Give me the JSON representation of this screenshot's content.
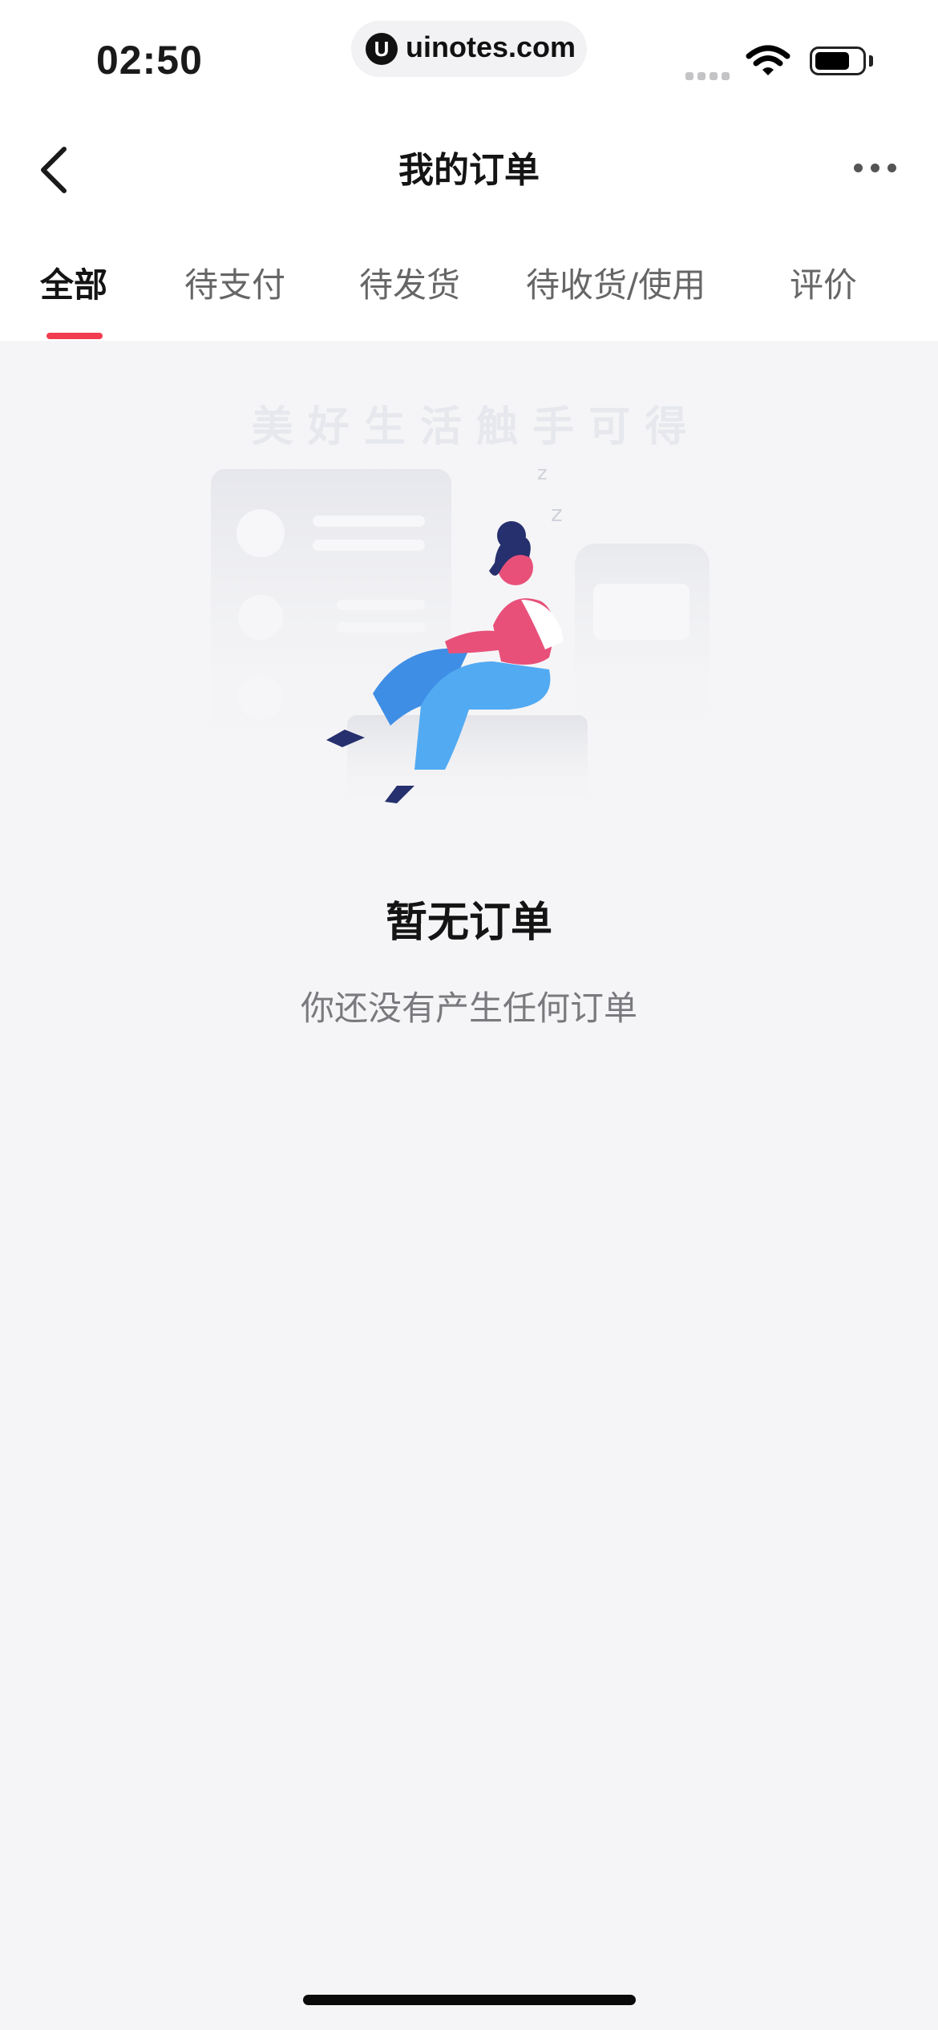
{
  "status_bar": {
    "time": "02:50",
    "url_logo": "U",
    "url": "uinotes.com",
    "icons": [
      "signal-icon",
      "wifi-icon",
      "battery-icon"
    ]
  },
  "nav": {
    "title": "我的订单",
    "icons": [
      "back-arrow-icon",
      "more-dots-icon"
    ]
  },
  "tabs": [
    {
      "label": "全部",
      "active": true
    },
    {
      "label": "待支付",
      "active": false
    },
    {
      "label": "待发货",
      "active": false
    },
    {
      "label": "待收货/使用",
      "active": false
    },
    {
      "label": "评价",
      "active": false
    }
  ],
  "empty_state": {
    "slogan": "美 好 生 活  触 手 可 得",
    "title": "暂无订单",
    "subtitle": "你还没有产生任何订单"
  },
  "colors": {
    "accent": "#f23d4f",
    "background": "#f5f5f7",
    "figure_pink": "#e8507a",
    "figure_blue": "#4fa3ee",
    "figure_navy": "#26306e"
  }
}
